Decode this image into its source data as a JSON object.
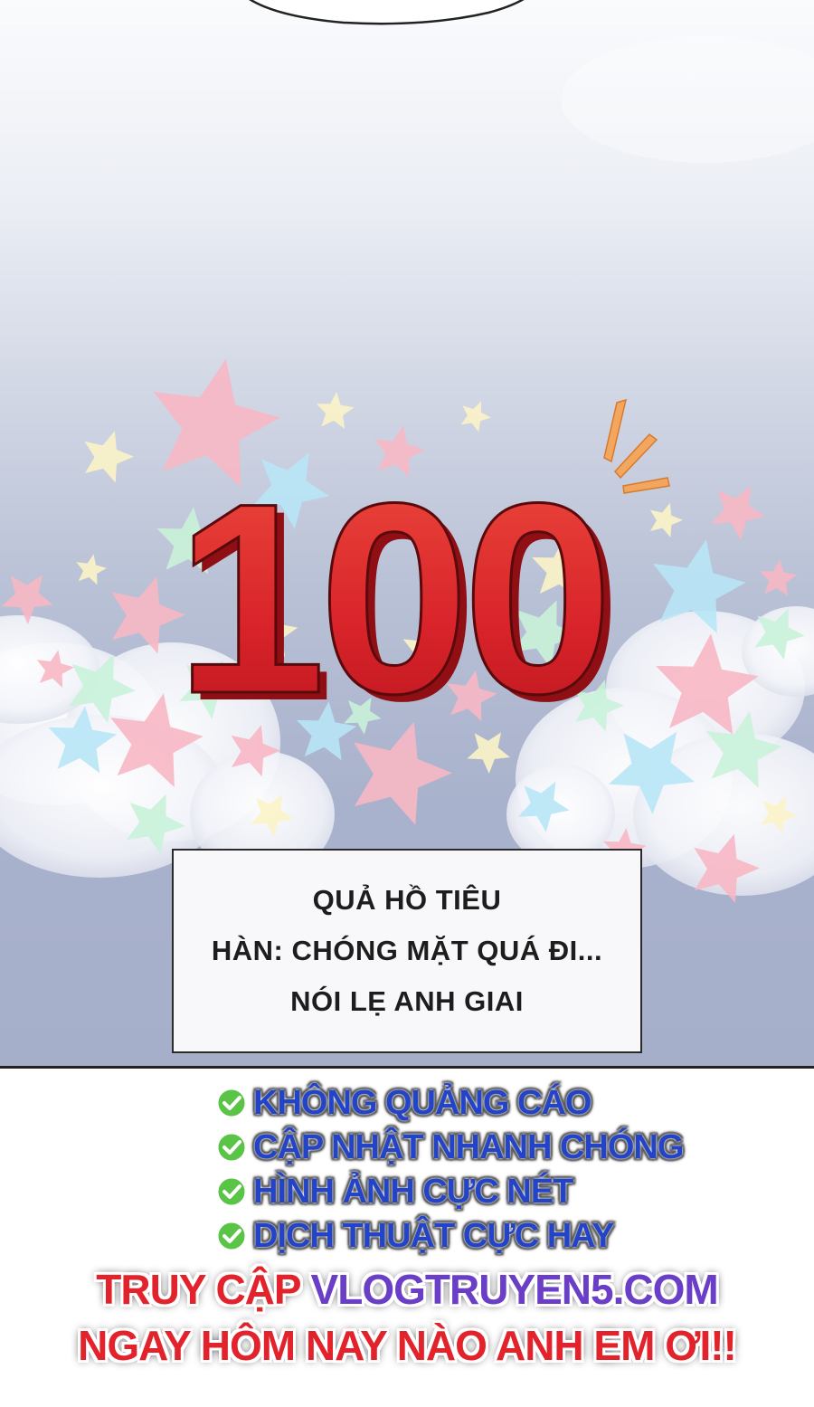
{
  "panel": {
    "counter": "100"
  },
  "caption": {
    "lines": [
      "QUẢ HỒ TIÊU",
      "HÀN: CHÓNG MẶT QUÁ ĐI...",
      "NÓI LẸ ANH GIAI"
    ]
  },
  "promo": {
    "features": [
      "KHÔNG QUẢNG CÁO",
      "CẬP NHẬT NHANH CHÓNG",
      "HÌNH ẢNH CỰC NÉT",
      "DỊCH THUẬT CỰC HAY"
    ],
    "cta_prefix": "TRUY CẬP",
    "cta_site": "VLOGTRUYEN5.COM",
    "cta_line2": "NGAY HÔM NAY NÀO ANH EM ƠI!!"
  },
  "colors": {
    "counter_red": "#d8232a",
    "feature_blue": "#2444c8",
    "check_green": "#5ac447",
    "cta_red": "#e2232c",
    "cta_purple": "#6a3ec6"
  },
  "icons": [
    "check-circle-icon",
    "star-icon",
    "cloud-icon",
    "burst-lines-icon"
  ]
}
